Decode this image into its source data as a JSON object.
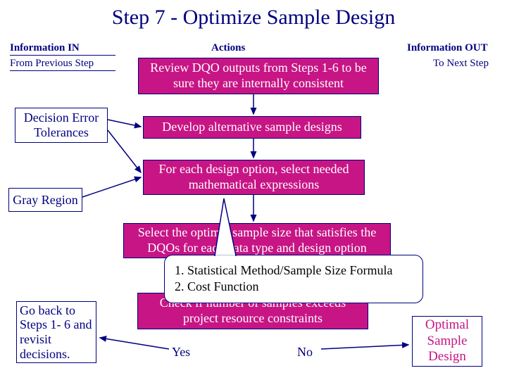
{
  "title": "Step 7 - Optimize Sample Design",
  "headers": {
    "info_in": "Information IN",
    "actions": "Actions",
    "info_out": "Information OUT",
    "from_prev": "From Previous Step",
    "to_next": "To Next Step"
  },
  "inputs": {
    "det": "Decision Error Tolerances",
    "gray": "Gray Region",
    "goback": "Go back to Steps 1- 6 and revisit decisions."
  },
  "actions": {
    "a1": "Review DQO outputs from Steps 1-6 to be sure they are internally consistent",
    "a2": "Develop alternative sample designs",
    "a3": "For each design option, select needed mathematical expressions",
    "a4": "Select the optimal sample size that satisfies the DQOs for each data type and design option",
    "a5": "Check if number of samples exceeds project resource constraints"
  },
  "callout": {
    "l1": "1.  Statistical Method/Sample Size Formula",
    "l2": "2.  Cost Function"
  },
  "decision": {
    "yes": "Yes",
    "no": "No"
  },
  "output": {
    "optimal": "Optimal Sample Design"
  }
}
